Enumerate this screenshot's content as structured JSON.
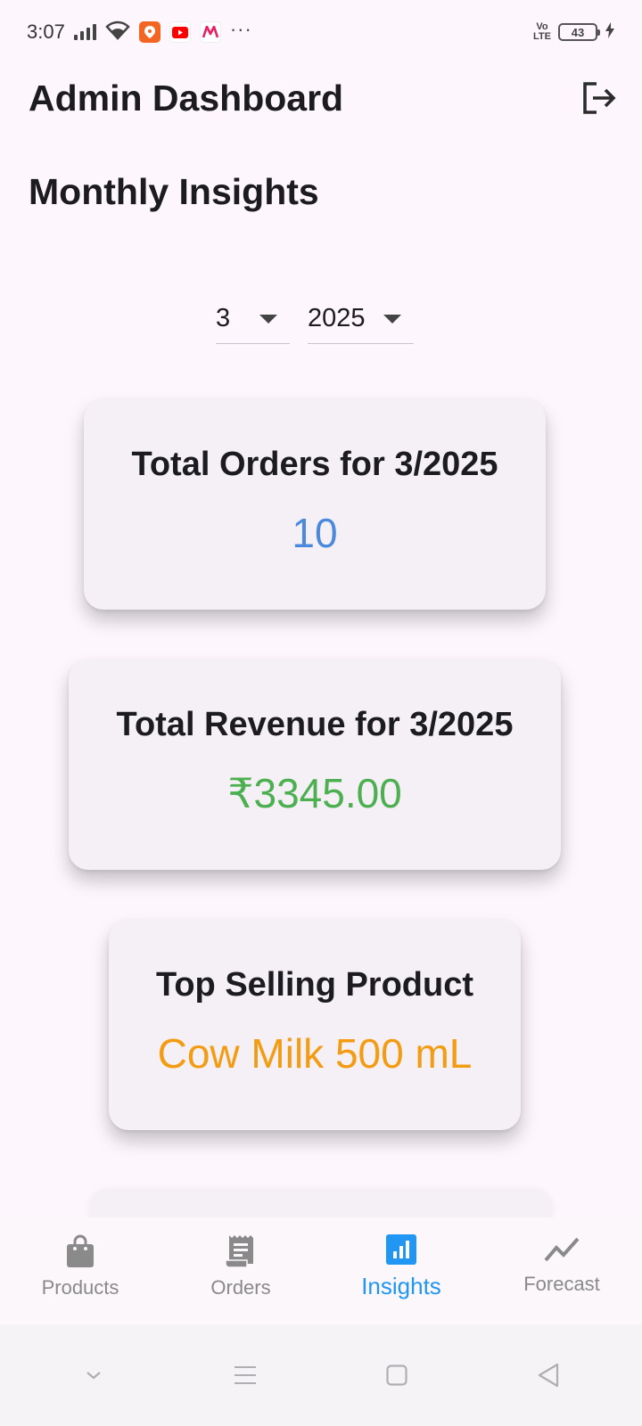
{
  "status_bar": {
    "time": "3:07",
    "volte": "Vo\nLTE",
    "battery": "43"
  },
  "app_bar": {
    "title": "Admin Dashboard"
  },
  "section_title": "Monthly Insights",
  "filters": {
    "month": "3",
    "year": "2025"
  },
  "cards": {
    "orders": {
      "title": "Total Orders for 3/2025",
      "value": "10",
      "color": "#4a89dc"
    },
    "revenue": {
      "title": "Total Revenue for 3/2025",
      "value": "₹3345.00",
      "color": "#4caf50"
    },
    "top_product": {
      "title": "Top Selling Product",
      "value": "Cow Milk 500 mL",
      "color": "#f39c12"
    }
  },
  "bottom_nav": {
    "items": [
      {
        "label": "Products",
        "icon": "shopping-bag-icon",
        "active": false
      },
      {
        "label": "Orders",
        "icon": "receipt-icon",
        "active": false
      },
      {
        "label": "Insights",
        "icon": "insights-icon",
        "active": true
      },
      {
        "label": "Forecast",
        "icon": "trending-icon",
        "active": false
      }
    ]
  },
  "colors": {
    "accent": "#2196f3",
    "background": "#fdf7fd",
    "card": "#f4f0f6"
  }
}
